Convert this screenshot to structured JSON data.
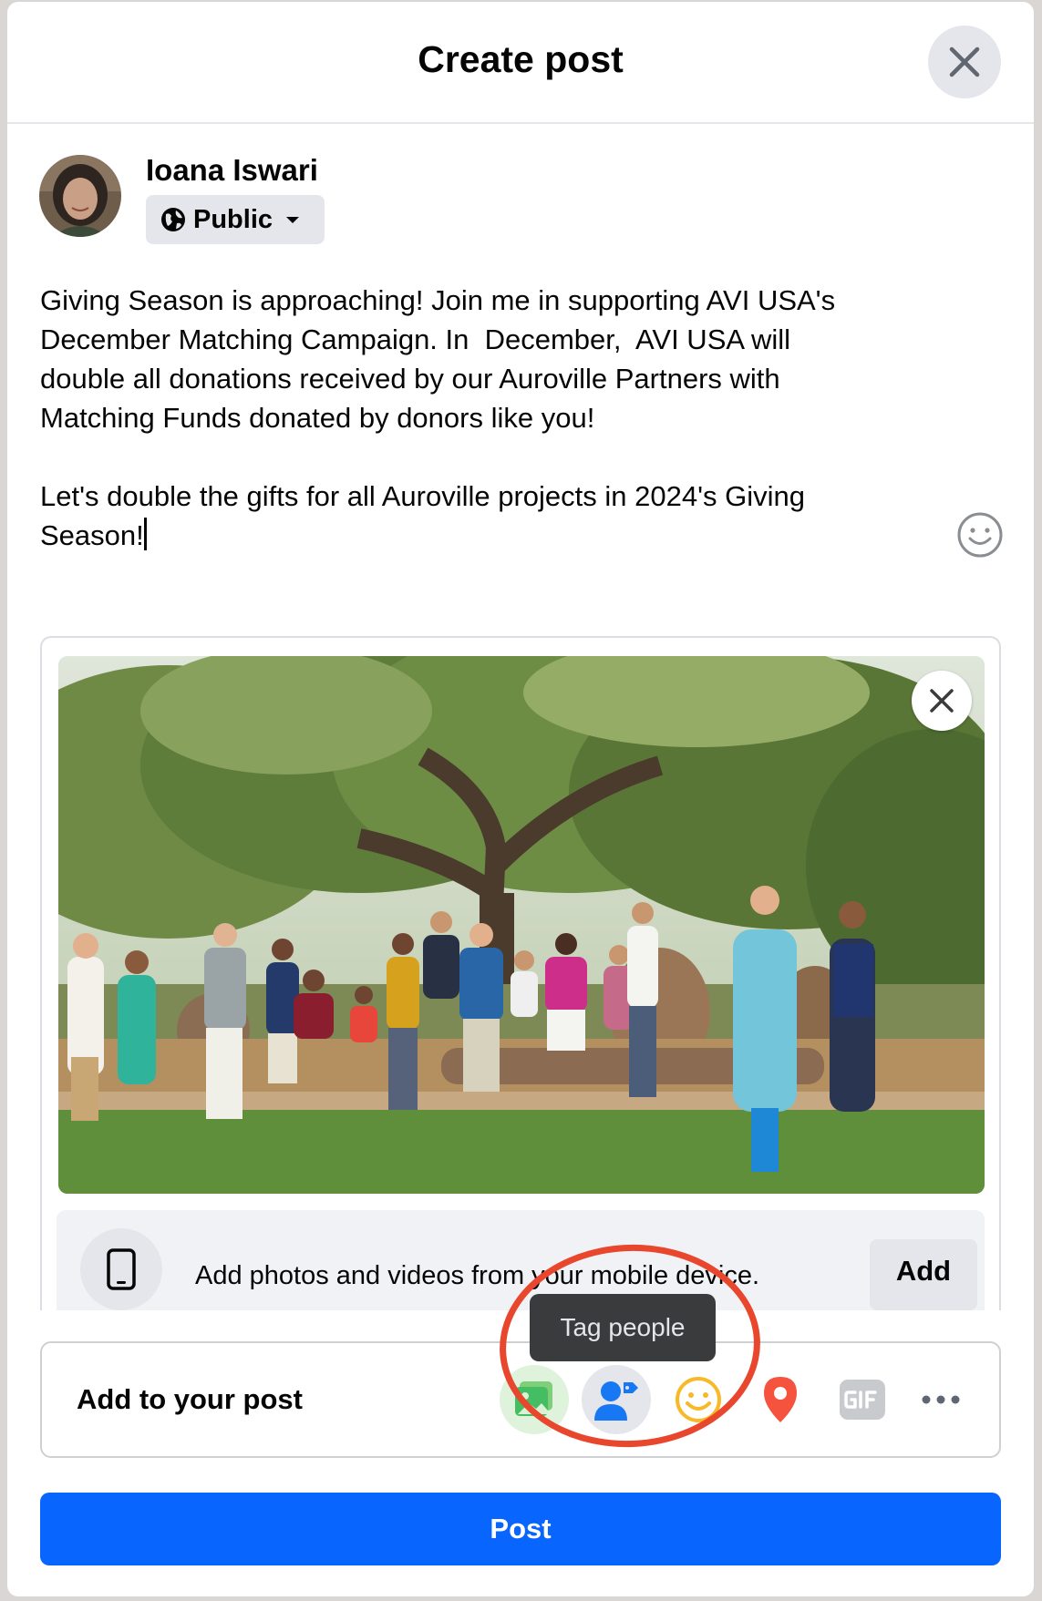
{
  "dialog": {
    "title": "Create post",
    "close_icon": "close-icon"
  },
  "author": {
    "name": "Ioana Iswari",
    "privacy": "Public",
    "privacy_icon": "globe-icon"
  },
  "post": {
    "paragraph_1": "Giving Season is approaching! Join me in supporting AVI USA's\nDecember Matching Campaign. In  December,  AVI USA will\ndouble all donations received by our Auroville Partners with\nMatching Funds donated by donors like you!",
    "paragraph_2": "Let's double the gifts for all Auroville projects in 2024's Giving\nSeason!"
  },
  "media": {
    "mobile_text": "Add photos and videos from your mobile device.",
    "mobile_add": "Add"
  },
  "add_to_post": {
    "label": "Add to your post",
    "tools": [
      "photo-video-icon",
      "tag-people-icon",
      "feeling-icon",
      "location-icon",
      "gif-icon",
      "more-icon"
    ]
  },
  "tooltip": {
    "text": "Tag people"
  },
  "post_button": {
    "label": "Post"
  },
  "colors": {
    "primary_blue": "#0866ff",
    "annotation_red": "#e8462d"
  }
}
